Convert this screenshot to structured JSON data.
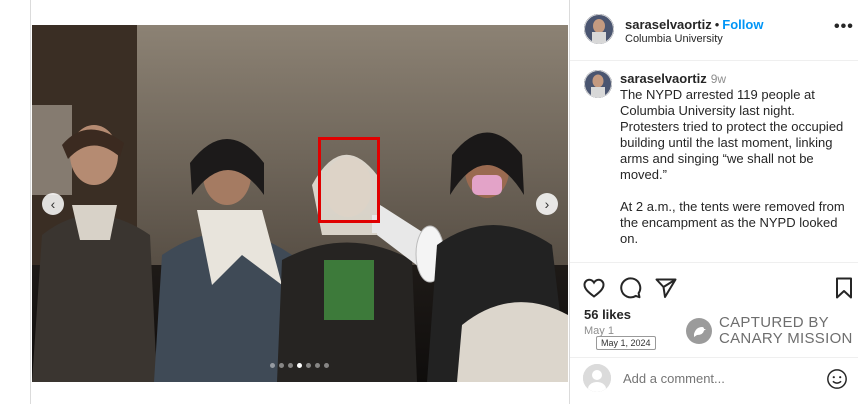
{
  "post": {
    "username": "saraselvaortiz",
    "follow_separator": "•",
    "follow_label": "Follow",
    "location": "Columbia University",
    "more_label": "•••",
    "caption_time": "9w",
    "caption_text": "The NYPD arrested 119 people at Columbia University last night. Protesters tried to protect the occupied building until the last moment, linking arms and singing “we shall not be moved.”\n\nAt 2 a.m., the tents were removed from the encampment as the NYPD looked on.",
    "likes": "56 likes",
    "date": "May 1",
    "date_tooltip": "May 1, 2024",
    "comment_placeholder": "Add a comment..."
  },
  "carousel": {
    "prev_label": "‹",
    "next_label": "›",
    "slide_count": 7,
    "active_index": 3
  },
  "watermark": {
    "line1": "CAPTURED BY",
    "line2": "CANARY MISSION"
  },
  "icons": [
    "heart-icon",
    "comment-icon",
    "share-icon",
    "bookmark-icon",
    "emoji-icon",
    "chevron-left-icon",
    "chevron-right-icon",
    "more-icon"
  ],
  "colors": {
    "accent": "#0095f6",
    "highlight_box": "#e00000"
  }
}
